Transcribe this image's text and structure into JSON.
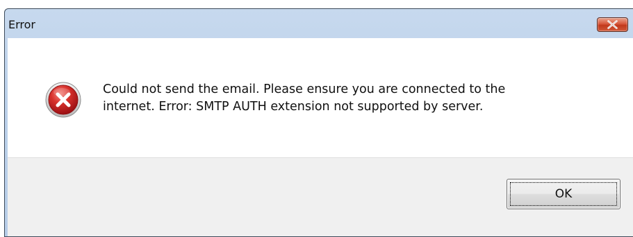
{
  "window": {
    "title": "Error"
  },
  "message": {
    "text": "Could not send the email. Please ensure you are connected to the\ninternet. Error: SMTP AUTH extension not supported by server."
  },
  "buttons": {
    "ok_label": "OK"
  },
  "icons": {
    "close": "close-icon",
    "error": "error-icon"
  },
  "colors": {
    "error_red": "#c8242a",
    "close_red": "#d0502f",
    "titlebar": "#bcd1ea",
    "button_area": "#f0f0f0"
  }
}
